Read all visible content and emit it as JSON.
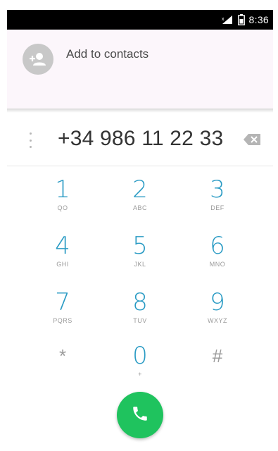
{
  "status_bar": {
    "time": "8:36",
    "icons": [
      "signal-icon",
      "battery-icon"
    ]
  },
  "contacts": {
    "add_label": "Add to contacts",
    "avatar_icon": "add-contact-icon"
  },
  "number_bar": {
    "phone_number": "+34 986 11 22 33",
    "overflow_icon": "overflow-menu-icon",
    "backspace_icon": "backspace-icon"
  },
  "dialpad": {
    "keys": [
      {
        "digit": "1",
        "letters": "QO"
      },
      {
        "digit": "2",
        "letters": "ABC"
      },
      {
        "digit": "3",
        "letters": "DEF"
      },
      {
        "digit": "4",
        "letters": "GHI"
      },
      {
        "digit": "5",
        "letters": "JKL"
      },
      {
        "digit": "6",
        "letters": "MNO"
      },
      {
        "digit": "7",
        "letters": "PQRS"
      },
      {
        "digit": "8",
        "letters": "TUV"
      },
      {
        "digit": "9",
        "letters": "WXYZ"
      },
      {
        "digit": "*",
        "letters": ""
      },
      {
        "digit": "0",
        "letters": "+"
      },
      {
        "digit": "#",
        "letters": ""
      }
    ]
  },
  "call_button": {
    "icon": "phone-icon",
    "color": "#1fc35e"
  },
  "colors": {
    "accent": "#2a9bc4",
    "status_bar": "#000000",
    "contacts_bg": "#fcf6fb"
  }
}
